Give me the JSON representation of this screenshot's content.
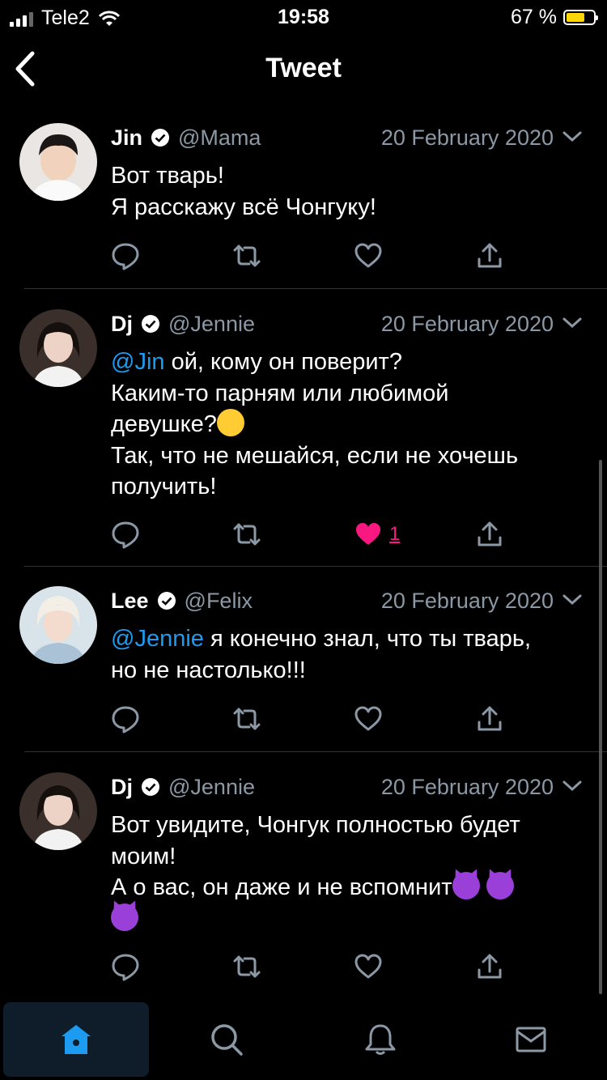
{
  "status_bar": {
    "carrier": "Tele2",
    "time": "19:58",
    "battery_percent": "67 %",
    "battery_level": 0.67,
    "battery_color": "#ffd60a"
  },
  "header": {
    "title": "Tweet",
    "back_icon": "chevron-left-icon"
  },
  "colors": {
    "background": "#000000",
    "accent": "#1d9bf0",
    "like": "#f91880",
    "secondary_text": "#8b98a5"
  },
  "tweets": [
    {
      "name": "Jin",
      "handle": "@Mama",
      "date": "20 February 2020",
      "lines": [
        "Вот тварь!",
        "Я расскажу всё Чонгуку!"
      ],
      "liked": false,
      "like_count": ""
    },
    {
      "name": "Dj",
      "handle": "@Jennie",
      "date": "20 February 2020",
      "mention": "@Jin",
      "line1_rest": " ой, кому он поверит?",
      "line2": "Каким-то парням или любимой",
      "line3": "девушке?",
      "line4": "Так, что не мешайся, если не хочешь",
      "line5": "получить!",
      "liked": true,
      "like_count": "1"
    },
    {
      "name": "Lee",
      "handle": "@Felix",
      "date": "20 February 2020",
      "mention": "@Jennie",
      "line1_rest": " я конечно знал, что ты тварь,",
      "line2": "но не настолько!!!",
      "liked": false,
      "like_count": ""
    },
    {
      "name": "Dj",
      "handle": "@Jennie",
      "date": "20 February 2020",
      "line1": "Вот увидите, Чонгук полностью будет",
      "line2": "моим!",
      "line3": "А о вас, он даже и не вспомнит",
      "liked": false,
      "like_count": ""
    }
  ],
  "tab_bar": {
    "items": [
      "home-icon",
      "search-icon",
      "notifications-icon",
      "messages-icon"
    ],
    "active": "home-icon"
  }
}
